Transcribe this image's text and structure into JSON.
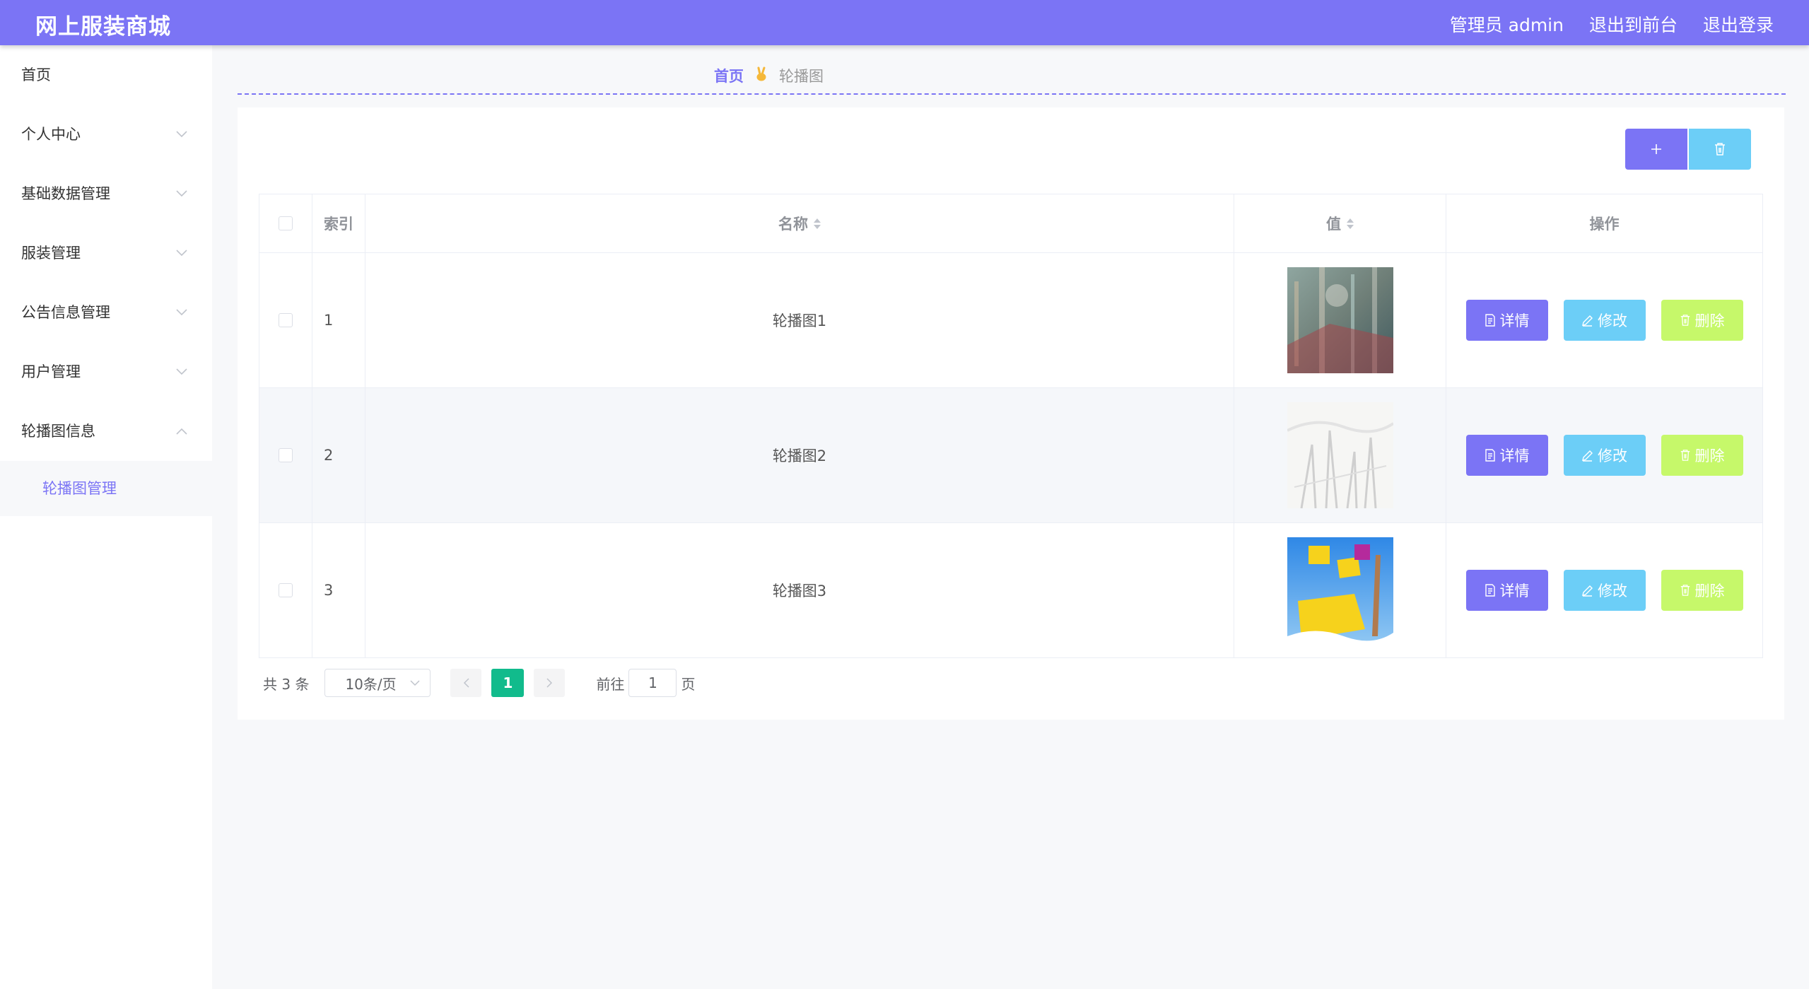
{
  "header": {
    "title": "网上服装商城",
    "links": [
      "管理员 admin",
      "退出到前台",
      "退出登录"
    ]
  },
  "sidebar": {
    "items": [
      {
        "label": "首页"
      },
      {
        "label": "个人中心"
      },
      {
        "label": "基础数据管理"
      },
      {
        "label": "服装管理"
      },
      {
        "label": "公告信息管理"
      },
      {
        "label": "用户管理"
      },
      {
        "label": "轮播图信息"
      }
    ],
    "sub_item": "轮播图管理"
  },
  "breadcrumb": {
    "home": "首页",
    "current": "轮播图"
  },
  "table": {
    "columns": {
      "index": "索引",
      "name": "名称",
      "value": "值",
      "actions": "操作"
    },
    "rows": [
      {
        "index": "1",
        "name": "轮播图1"
      },
      {
        "index": "2",
        "name": "轮播图2"
      },
      {
        "index": "3",
        "name": "轮播图3"
      }
    ],
    "actions": {
      "detail": "详情",
      "edit": "修改",
      "delete": "删除"
    }
  },
  "pagination": {
    "total": "共 3 条",
    "page_size": "10条/页",
    "current_page": "1",
    "goto_label": "前往",
    "goto_value": "1",
    "page_unit": "页"
  },
  "colors": {
    "accent": "#7b74f5",
    "info": "#6ccef7",
    "danger": "#c6f86a",
    "page_active": "#11bb8c"
  }
}
